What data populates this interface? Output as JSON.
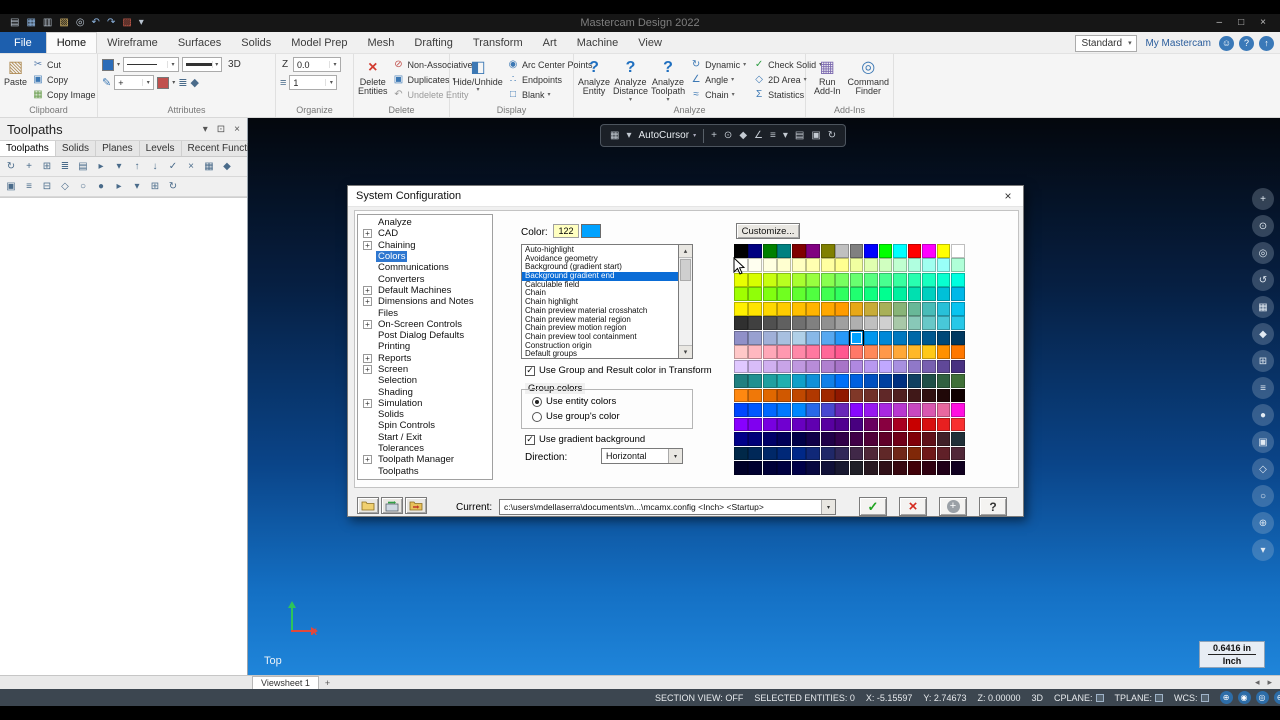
{
  "window": {
    "title": "Mastercam Design 2022",
    "controls": [
      {
        "glyph": "–",
        "name": "minimize-button"
      },
      {
        "glyph": "□",
        "name": "maximize-button"
      },
      {
        "glyph": "×",
        "name": "close-button"
      }
    ],
    "quick_access": [
      {
        "glyph": "▤",
        "color": "#b9c4d0",
        "name": "new-file-icon"
      },
      {
        "glyph": "▦",
        "color": "#8fb7e3",
        "name": "save-icon"
      },
      {
        "glyph": "▥",
        "color": "#b9c4d0",
        "name": "print-icon"
      },
      {
        "glyph": "▧",
        "color": "#d9b96a",
        "name": "open-icon"
      },
      {
        "glyph": "◎",
        "color": "#b9c4d0",
        "name": "zoom-window-icon"
      },
      {
        "glyph": "↶",
        "color": "#8fb7e3",
        "name": "undo-icon"
      },
      {
        "glyph": "↷",
        "color": "#8fb7e3",
        "name": "redo-icon"
      },
      {
        "glyph": "▨",
        "color": "#d4604f",
        "name": "recent-files-icon"
      },
      {
        "glyph": "▾",
        "color": "#b9c4d0",
        "name": "qat-menu-icon"
      }
    ]
  },
  "ribbon": {
    "tabs": [
      {
        "label": "File",
        "file": true
      },
      {
        "label": "Home",
        "active": true
      },
      {
        "label": "Wireframe"
      },
      {
        "label": "Surfaces"
      },
      {
        "label": "Solids"
      },
      {
        "label": "Model Prep"
      },
      {
        "label": "Mesh"
      },
      {
        "label": "Drafting"
      },
      {
        "label": "Transform"
      },
      {
        "label": "Art"
      },
      {
        "label": "Machine"
      },
      {
        "label": "View"
      }
    ],
    "right": {
      "style_value": "Standard",
      "account_label": "My Mastercam",
      "icons": [
        {
          "glyph": "☺",
          "name": "feedback-icon"
        },
        {
          "glyph": "?",
          "name": "help-icon"
        },
        {
          "glyph": "↑",
          "name": "share-icon"
        }
      ]
    },
    "groups": [
      {
        "label": "Clipboard",
        "big0": "Paste",
        "small0": "Cut",
        "small1": "Copy",
        "small2": "Copy Image"
      },
      {
        "label": "Attributes",
        "threed": "3D"
      },
      {
        "label": "Organize",
        "z_label": "Z",
        "z_value": "0.0",
        "level_value": "1"
      },
      {
        "label": "Delete",
        "big0": "Delete Entities",
        "small0": "Non-Associative",
        "small1": "Duplicates",
        "small2": "Undelete Entity"
      },
      {
        "label": "Display",
        "big0": "Hide/Unhide",
        "small0": "Arc Center Points",
        "small1": "Endpoints",
        "small2": "Blank"
      },
      {
        "label": "Analyze",
        "big0": "Analyze Entity",
        "big1": "Analyze Distance",
        "big2": "Analyze Toolpath",
        "small0": "Dynamic",
        "small1": "Angle",
        "small2": "Chain",
        "small3": "Check Solid",
        "small4": "2D Area",
        "small5": "Statistics"
      },
      {
        "label": "Add-Ins",
        "big0": "Run Add-In",
        "big1": "Command Finder"
      }
    ]
  },
  "panel": {
    "title": "Toolpaths",
    "header_icons": [
      {
        "glyph": "▾",
        "name": "panel-menu-icon"
      },
      {
        "glyph": "⊡",
        "name": "pin-icon"
      },
      {
        "glyph": "×",
        "name": "panel-close-icon"
      }
    ],
    "tabs": [
      {
        "label": "Toolpaths",
        "active": true
      },
      {
        "label": "Solids"
      },
      {
        "label": "Planes"
      },
      {
        "label": "Levels"
      },
      {
        "label": "Recent Functions"
      }
    ],
    "toolbar1": [
      "↻",
      "+",
      "⊞",
      "≣",
      "▤",
      "▸",
      "▾",
      "↑",
      "↓",
      "✓",
      "×",
      "▦",
      "◆"
    ],
    "toolbar2": [
      "▣",
      "≡",
      "⊟",
      "◇",
      "○",
      "●",
      "▸",
      "▾",
      "⊞",
      "↻"
    ]
  },
  "viewport": {
    "view_label": "Top",
    "autocursor_label": "AutoCursor",
    "floatbar_pre": [
      "▦",
      "▾"
    ],
    "floatbar_post": [
      "+",
      "⊙",
      "◆",
      "∠",
      "≡",
      "▾",
      "▤",
      "▣",
      "↻"
    ],
    "right_buttons": [
      "+",
      "⊙",
      "◎",
      "↺",
      "▦",
      "◆",
      "⊞",
      "≡",
      "●",
      "▣",
      "◇",
      "○",
      "⊕",
      "▾"
    ],
    "scale_value": "0.6416 in",
    "scale_unit": "Inch"
  },
  "sheetbar": {
    "tab": "Viewsheet 1",
    "add": "+",
    "nav_left": "◂",
    "nav_right": "▸"
  },
  "statusbar": {
    "fields": [
      {
        "text": "SECTION VIEW: OFF",
        "name": "section-view-status",
        "inter": true
      },
      {
        "text": "SELECTED ENTITIES: 0",
        "name": "selected-entities-status",
        "inter": false
      },
      {
        "text": "X: -5.15597",
        "name": "cursor-x-readout",
        "inter": false
      },
      {
        "text": "Y: 2.74673",
        "name": "cursor-y-readout",
        "inter": false
      },
      {
        "text": "Z: 0.00000",
        "name": "cursor-z-readout",
        "inter": false
      },
      {
        "text": "3D",
        "name": "mode-3d-toggle",
        "inter": true
      },
      {
        "text": "CPLANE:",
        "name": "cplane-selector",
        "inter": true,
        "square": true
      },
      {
        "text": "TPLANE:",
        "name": "tplane-selector",
        "inter": true,
        "square": true
      },
      {
        "text": "WCS:",
        "name": "wcs-selector",
        "inter": true,
        "square": true
      }
    ],
    "icons": [
      "⊕",
      "◉",
      "◎",
      "⊖",
      "⊙"
    ]
  },
  "dialog": {
    "title": "System Configuration",
    "close_glyph": "×",
    "expander": "+",
    "tree": [
      {
        "label": "Analyze"
      },
      {
        "label": "CAD",
        "expand": true
      },
      {
        "label": "Chaining",
        "expand": true
      },
      {
        "label": "Colors",
        "selected": true
      },
      {
        "label": "Communications"
      },
      {
        "label": "Converters"
      },
      {
        "label": "Default Machines",
        "expand": true
      },
      {
        "label": "Dimensions and Notes",
        "expand": true
      },
      {
        "label": "Files"
      },
      {
        "label": "On-Screen Controls",
        "expand": true
      },
      {
        "label": "Post Dialog Defaults"
      },
      {
        "label": "Printing"
      },
      {
        "label": "Reports",
        "expand": true
      },
      {
        "label": "Screen",
        "expand": true
      },
      {
        "label": "Selection"
      },
      {
        "label": "Shading"
      },
      {
        "label": "Simulation",
        "expand": true
      },
      {
        "label": "Solids"
      },
      {
        "label": "Spin Controls"
      },
      {
        "label": "Start / Exit"
      },
      {
        "label": "Tolerances"
      },
      {
        "label": "Toolpath Manager",
        "expand": true
      },
      {
        "label": "Toolpaths"
      }
    ],
    "color_label": "Color:",
    "color_value": "122",
    "color_swatch": "#00A2FF",
    "customize_button": "Customize...",
    "items": [
      "Auto-highlight",
      "Avoidance geometry",
      "Background (gradient start)",
      "Background gradient end",
      "Calculable field",
      "Chain",
      "Chain highlight",
      "Chain preview material crosshatch",
      "Chain preview material region",
      "Chain preview motion region",
      "Chain preview tool containment",
      "Construction origin",
      "Default groups"
    ],
    "selected_item": 3,
    "transform_checkbox": "Use Group and Result color in Transform",
    "group_colors_label": "Group colors",
    "radio_entity": "Use entity colors",
    "radio_group": "Use group's color",
    "gradient_checkbox": "Use gradient background",
    "direction_label": "Direction:",
    "direction_value": "Horizontal",
    "current_label": "Current:",
    "current_value": "c:\\users\\mdellaserra\\documents\\m...\\mcamx.config <Inch> <Startup>",
    "check_glyph": "✓",
    "buttons": {
      "ok": "✓",
      "cancel": "×",
      "add": "+",
      "help": "?"
    },
    "palette_selected": {
      "row": 6,
      "col": 8
    },
    "palette": [
      [
        "#000000",
        "#000080",
        "#008000",
        "#008080",
        "#800000",
        "#800080",
        "#808000",
        "#C0C0C0",
        "#808080",
        "#0000FF",
        "#00FF00",
        "#00FFFF",
        "#FF0000",
        "#FF00FF",
        "#FFFF00",
        "#FFFFFF"
      ],
      [
        "#FFFFF8",
        "#FFFFF0",
        "#FFFFE0",
        "#FFFFD0",
        "#FFFFC0",
        "#FFFFB0",
        "#FFFFA0",
        "#FFFF90",
        "#F0FFA0",
        "#E0FFB0",
        "#D0FFC0",
        "#C0FFD0",
        "#B0FFE0",
        "#A0FFF0",
        "#98FFF8",
        "#B0FFD8"
      ],
      [
        "#E8FF00",
        "#D8FF00",
        "#C8FF10",
        "#B8FF20",
        "#A8FF30",
        "#98FF40",
        "#88FF50",
        "#78FF60",
        "#68FF70",
        "#58FF80",
        "#48FF90",
        "#38FFA0",
        "#28FFB0",
        "#18FFC0",
        "#08FFD0",
        "#00FFE0"
      ],
      [
        "#A0FF00",
        "#90FF08",
        "#80FF10",
        "#70FF20",
        "#60FF30",
        "#50FF40",
        "#40FF50",
        "#30FF60",
        "#20FF70",
        "#10FF80",
        "#00FF90",
        "#00F0A0",
        "#00E0B0",
        "#00D0C0",
        "#00C0D8",
        "#00B8E8"
      ],
      [
        "#FFF000",
        "#FFE400",
        "#FFD800",
        "#FFCC00",
        "#FFC000",
        "#FFB400",
        "#FFA800",
        "#FF9C00",
        "#E8A818",
        "#C8AC38",
        "#A8B058",
        "#88B478",
        "#68B898",
        "#48BCB8",
        "#28C0D8",
        "#08C4F0"
      ],
      [
        "#303030",
        "#404040",
        "#505050",
        "#606060",
        "#707070",
        "#808080",
        "#909090",
        "#A0A0A0",
        "#B0B0B0",
        "#C0C0C0",
        "#D0D0D0",
        "#A8C8A8",
        "#88C8B8",
        "#68C8C8",
        "#48C8D8",
        "#28C8E8"
      ],
      [
        "#9090C8",
        "#98A0D0",
        "#A0B0D8",
        "#A8C0E0",
        "#B0D0E8",
        "#88B8E8",
        "#58A8F0",
        "#2898F8",
        "#00A2FF",
        "#0096EE",
        "#0088D8",
        "#0078C0",
        "#0068A8",
        "#005890",
        "#004878",
        "#003860"
      ],
      [
        "#FFC8C8",
        "#FFB8C0",
        "#FFA8B8",
        "#FF98B0",
        "#FF88A8",
        "#FF78A0",
        "#FF6898",
        "#FF5890",
        "#FF7868",
        "#FF8858",
        "#FF9848",
        "#FFA838",
        "#FFB828",
        "#FFC818",
        "#FF9000",
        "#FF7800"
      ],
      [
        "#E0C8FF",
        "#D8BCF8",
        "#D0B0F0",
        "#C8A4E8",
        "#C098E0",
        "#B88CD8",
        "#B080D0",
        "#A874C8",
        "#B088E0",
        "#B898F0",
        "#C0A8FF",
        "#A890E0",
        "#9078C8",
        "#7860B0",
        "#604898",
        "#483080"
      ],
      [
        "#208080",
        "#209090",
        "#20A0A0",
        "#20B0B0",
        "#10A0C8",
        "#1090D8",
        "#1080E8",
        "#0070F8",
        "#0060E0",
        "#0050C0",
        "#0040A0",
        "#003080",
        "#104060",
        "#205048",
        "#306040",
        "#407038"
      ],
      [
        "#FF8810",
        "#F07808",
        "#E06800",
        "#D05800",
        "#C04800",
        "#B03800",
        "#A02800",
        "#901800",
        "#803828",
        "#703028",
        "#602828",
        "#502020",
        "#401818",
        "#301010",
        "#200808",
        "#100000"
      ],
      [
        "#0048FF",
        "#0058FF",
        "#0068FF",
        "#0078FF",
        "#0088FF",
        "#2868E8",
        "#4848D0",
        "#6828B8",
        "#8808FF",
        "#9818F0",
        "#A828E0",
        "#B838D0",
        "#C848C0",
        "#D858B0",
        "#E868A0",
        "#FF10E0"
      ],
      [
        "#8800FF",
        "#8000F0",
        "#7800E0",
        "#7000D0",
        "#6800C0",
        "#6000B0",
        "#5800A0",
        "#500090",
        "#480080",
        "#680060",
        "#880040",
        "#A80020",
        "#C80000",
        "#D81010",
        "#E82020",
        "#F83030"
      ],
      [
        "#000088",
        "#000078",
        "#000068",
        "#000058",
        "#000048",
        "#100048",
        "#200048",
        "#300048",
        "#400048",
        "#500038",
        "#600028",
        "#700018",
        "#800008",
        "#601018",
        "#402028",
        "#203038"
      ],
      [
        "#002848",
        "#002858",
        "#002868",
        "#002878",
        "#002888",
        "#102878",
        "#202868",
        "#302858",
        "#402848",
        "#502838",
        "#602828",
        "#702818",
        "#802808",
        "#701818",
        "#602028",
        "#502838"
      ],
      [
        "#000028",
        "#000030",
        "#000038",
        "#000040",
        "#000048",
        "#080840",
        "#101038",
        "#181830",
        "#202028",
        "#281820",
        "#301018",
        "#380810",
        "#400008",
        "#300010",
        "#200018",
        "#100020"
      ]
    ]
  }
}
